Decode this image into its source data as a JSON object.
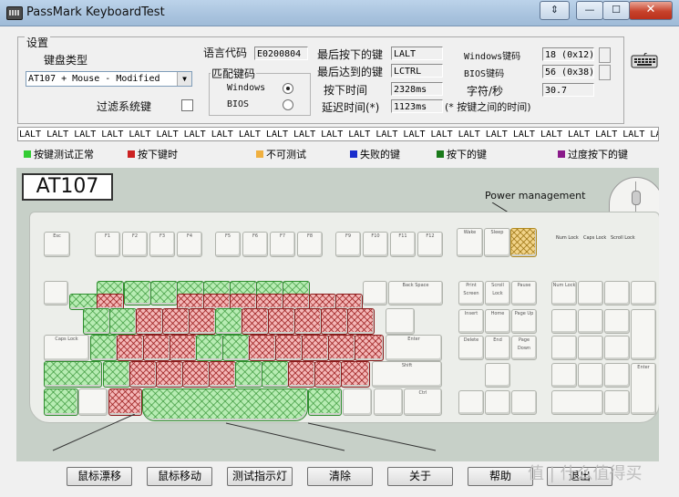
{
  "window": {
    "title": "PassMark KeyboardTest",
    "controls": {
      "help": "⇕",
      "minimize": "—",
      "maximize": "☐",
      "close": "✕"
    }
  },
  "settings": {
    "group_label": "设置",
    "keyboard_type_label": "键盘类型",
    "keyboard_type_value": "AT107 + Mouse - Modified",
    "filter_system_keys_label": "过滤系统键",
    "language_code_label": "语言代码",
    "language_code_value": "E0200804",
    "mapping_label": "匹配键码",
    "mapping_options": [
      "Windows",
      "BIOS"
    ],
    "mapping_selected": "Windows",
    "last_pressed_label": "最后按下的键",
    "last_pressed_value": "LALT",
    "last_released_label": "最后达到的键",
    "last_released_value": "LCTRL",
    "press_time_label": "按下时间",
    "press_time_value": "2328ms",
    "delay_time_label": "延迟时间(*)",
    "delay_time_value": "1123ms",
    "delay_note": "(* 按键之间的时间)",
    "windows_code_label": "Windows键码",
    "windows_code_value": "18 (0x12)",
    "bios_code_label": "BIOS键码",
    "bios_code_value": "56 (0x38)",
    "chars_per_sec_label": "字符/秒",
    "chars_per_sec_value": "30.7"
  },
  "log_text": "LALT LALT LALT LALT LALT LALT LALT LALT LALT LALT LALT LALT LALT LALT LALT LALT LALT LALT LALT LALT LALT LALT LALT LALT LALT LA",
  "legend": [
    {
      "label": "按键测试正常",
      "color": "#33cc33"
    },
    {
      "label": "按下键时",
      "color": "#cc2222"
    },
    {
      "label": "不可测试",
      "color": "#f0b040"
    },
    {
      "label": "失败的键",
      "color": "#1a2dcc"
    },
    {
      "label": "按下的键",
      "color": "#1a7a1a"
    },
    {
      "label": "过度按下的键",
      "color": "#8a1a8a"
    }
  ],
  "keyboard_image": {
    "model_label": "AT107",
    "power_label": "Power management",
    "keycaps": {
      "esc": "Esc",
      "f1": "F1",
      "f2": "F2",
      "f3": "F3",
      "f4": "F4",
      "f5": "F5",
      "f6": "F6",
      "f7": "F7",
      "f8": "F8",
      "f9": "F9",
      "f10": "F10",
      "f11": "F11",
      "f12": "F12",
      "wake": "Wake",
      "sleep": "Sleep",
      "num_lock_led": "Num Lock",
      "caps_lock_led": "Caps Lock",
      "scroll_lock_led": "Scroll Lock",
      "backspace": "Back Space",
      "caps_lock": "Caps Lock",
      "enter": "Enter",
      "shift": "Shift",
      "ctrl": "Ctrl",
      "print_screen": "Print Screen",
      "scroll_lock": "Scroll Lock",
      "pause": "Pause",
      "insert": "Insert",
      "home": "Home",
      "page_up": "Page Up",
      "delete": "Delete",
      "end": "End",
      "page_down": "Page Down",
      "num_lock": "Num Lock",
      "num_enter": "Enter"
    }
  },
  "buttons": [
    "鼠标漂移",
    "鼠标移动",
    "测试指示灯",
    "清除",
    "关于",
    "帮助",
    "退出"
  ],
  "watermark": "值 | 什么值得买"
}
